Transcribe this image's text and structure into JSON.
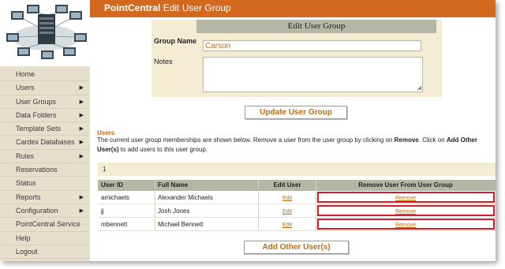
{
  "header": {
    "brand": "PointCentral",
    "title": "Edit User Group"
  },
  "sidebar": {
    "items": [
      {
        "label": "Home",
        "has_arrow": false
      },
      {
        "label": "Users",
        "has_arrow": true
      },
      {
        "label": "User Groups",
        "has_arrow": true
      },
      {
        "label": "Data Folders",
        "has_arrow": true
      },
      {
        "label": "Template Sets",
        "has_arrow": true
      },
      {
        "label": "Cardex Databases",
        "has_arrow": true
      },
      {
        "label": "Rules",
        "has_arrow": true
      },
      {
        "label": "Reservations",
        "has_arrow": false
      },
      {
        "label": "Status",
        "has_arrow": false
      },
      {
        "label": "Reports",
        "has_arrow": true
      },
      {
        "label": "Configuration",
        "has_arrow": true
      },
      {
        "label": "PointCentral Service",
        "has_arrow": false
      },
      {
        "label": "Help",
        "has_arrow": false
      },
      {
        "label": "Logout",
        "has_arrow": false
      }
    ],
    "arrow_glyph": "▶"
  },
  "form": {
    "heading": "Edit User Group",
    "group_name_label": "Group Name",
    "group_name_value": "Carson",
    "notes_label": "Notes",
    "notes_value": ""
  },
  "update_button": "Update User Group",
  "users": {
    "title": "Users",
    "desc_1": "The current user group memberships are shown below. Remove a user from the user group by clicking on ",
    "desc_remove": "Remove",
    "desc_2": ". Click on ",
    "desc_add": "Add Other User(s)",
    "desc_3": " to add users to this user group.",
    "count": "1",
    "columns": [
      "User ID",
      "Full Name",
      "Edit User",
      "Remove User From User Group"
    ],
    "rows": [
      {
        "user_id": "amichaels",
        "full_name": "Alexander Michaels",
        "edit": "Edit",
        "remove": "Remove"
      },
      {
        "user_id": "jj",
        "full_name": "Josh Jones",
        "edit": "Edit",
        "remove": "Remove"
      },
      {
        "user_id": "mbennett",
        "full_name": "Michael Bennett",
        "edit": "Edit",
        "remove": "Remove"
      }
    ]
  },
  "add_button": "Add Other User(s)",
  "colors": {
    "header_orange": "#d2691e",
    "sidebar_beige": "#e6dfcc",
    "panel_beige": "#f3ecd2",
    "table_header_gray": "#b4b7a6",
    "link_orange": "#c06a10",
    "highlight_red": "#d21e2a"
  }
}
